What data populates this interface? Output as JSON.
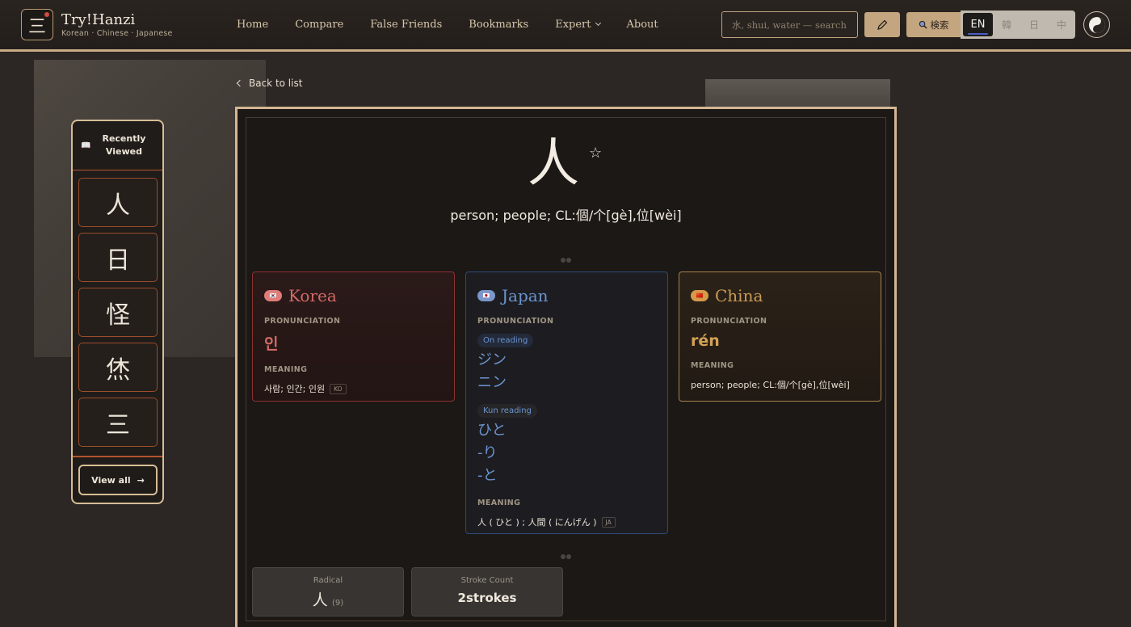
{
  "header": {
    "logo_glyph": "三",
    "brand_name": "Try!Hanzi",
    "brand_sub": "Korean · Chinese · Japanese",
    "nav": [
      "Home",
      "Compare",
      "False Friends",
      "Bookmarks",
      "Expert",
      "About"
    ],
    "search_placeholder": "水, shui, water — search",
    "search_button": "検索",
    "languages": [
      "EN",
      "韓",
      "日",
      "中"
    ],
    "active_language": "EN",
    "icons": [
      "pencil-icon",
      "search-icon",
      "yin-yang-icon"
    ]
  },
  "sidebar": {
    "title_line1": "Recently",
    "title_line2": "Viewed",
    "items": [
      "人",
      "日",
      "怪",
      "烋",
      "三"
    ],
    "view_all": "View all"
  },
  "main": {
    "back_label": "Back to list",
    "character": "人",
    "star": "☆",
    "meaning": "person; people; CL:個/个[gè],位[wèi]",
    "regions": {
      "korea": {
        "title": "Korea",
        "flag": "🇰🇷",
        "pronunciation_label": "PRONUNCIATION",
        "pronunciation": "인",
        "meaning_label": "MEANING",
        "meaning": "사람; 인간; 인원",
        "lang_tag": "KO"
      },
      "japan": {
        "title": "Japan",
        "flag": "🇯🇵",
        "pronunciation_label": "PRONUNCIATION",
        "on_label": "On reading",
        "on_readings": [
          "ジン",
          "ニン"
        ],
        "kun_label": "Kun reading",
        "kun_readings": [
          "ひと",
          "-り",
          "-と"
        ],
        "meaning_label": "MEANING",
        "meaning": "人 ( ひと ) ; 人間 ( にんげん )",
        "lang_tag": "JA"
      },
      "china": {
        "title": "China",
        "flag": "🇨🇳",
        "pronunciation_label": "PRONUNCIATION",
        "pronunciation": "rén",
        "meaning_label": "MEANING",
        "meaning": "person; people; CL:個/个[gè],位[wèi]"
      }
    },
    "radical_label": "Radical",
    "radical": "人",
    "radical_count": "(9)",
    "stroke_label": "Stroke Count",
    "stroke_count": "2strokes"
  },
  "colors": {
    "accent_gold": "#d3b793",
    "korea": "#d46a67",
    "japan": "#6b94cf",
    "china": "#c99b55"
  }
}
